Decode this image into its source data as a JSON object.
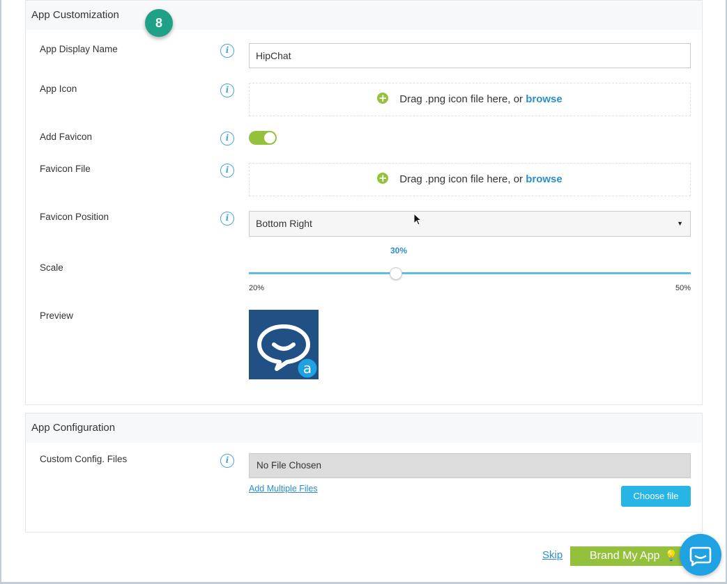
{
  "customization": {
    "title": "App Customization",
    "step_number": "8",
    "display_name": {
      "label": "App Display Name",
      "value": "HipChat"
    },
    "app_icon": {
      "label": "App Icon",
      "prompt": "Drag .png icon file here, or ",
      "browse": "browse"
    },
    "favicon_toggle": {
      "label": "Add Favicon",
      "enabled": true
    },
    "favicon_file": {
      "label": "Favicon File",
      "prompt": "Drag .png icon file here, or ",
      "browse": "browse"
    },
    "favicon_position": {
      "label": "Favicon Position",
      "selected": "Bottom Right"
    },
    "scale": {
      "label": "Scale",
      "value_text": "30%",
      "min": "20%",
      "max": "50%",
      "fraction": 0.333
    },
    "preview": {
      "label": "Preview",
      "badge_letter": "a"
    }
  },
  "configuration": {
    "title": "App Configuration",
    "custom_config": {
      "label": "Custom Config. Files",
      "file_status": "No File Chosen"
    },
    "add_multiple": "Add Multiple Files",
    "choose_file": "Choose file"
  },
  "footer": {
    "skip": "Skip",
    "brand_button": "Brand My App",
    "bulb_icon": "lightbulb-icon"
  },
  "colors": {
    "accent_green": "#94c13c",
    "accent_blue": "#2d8fc9",
    "button_blue": "#26b5e4",
    "badge_teal": "#1fa185",
    "preview_bg": "#215084"
  }
}
